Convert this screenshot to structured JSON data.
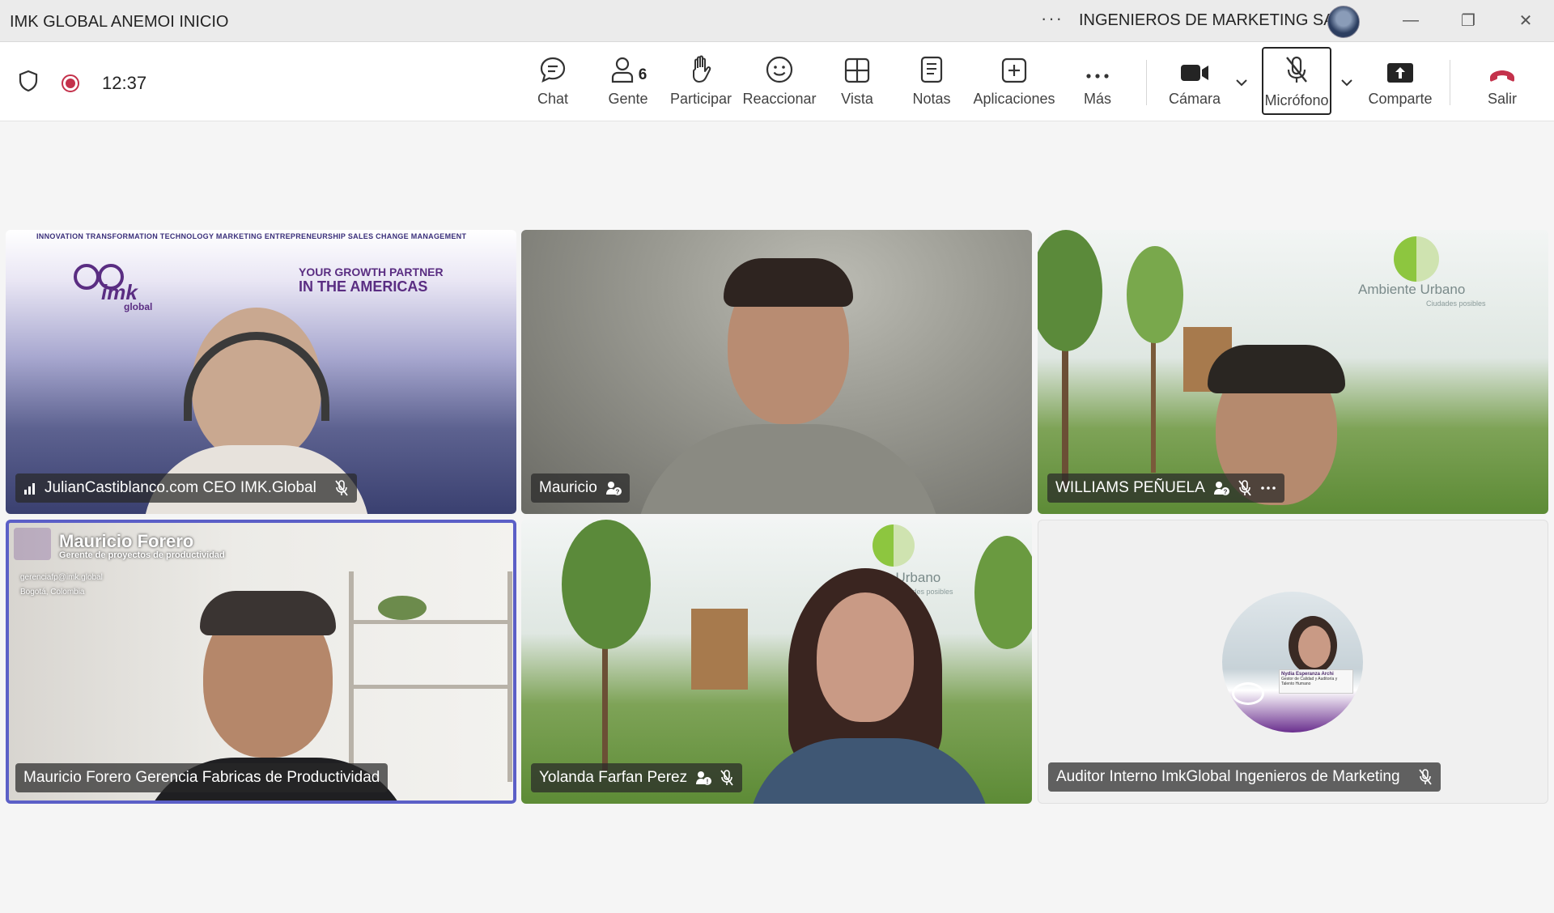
{
  "titlebar": {
    "title": "IMK GLOBAL ANEMOI INICIO",
    "more": "···",
    "organization": "INGENIEROS DE MARKETING SAS",
    "minimize": "—",
    "restore": "❐",
    "close": "✕"
  },
  "meeting": {
    "timer": "12:37"
  },
  "toolbar": {
    "chat": "Chat",
    "people": "Gente",
    "people_count": "6",
    "raise_hand": "Participar",
    "react": "Reaccionar",
    "view": "Vista",
    "notes": "Notas",
    "apps": "Aplicaciones",
    "more": "Más",
    "camera": "Cámara",
    "mic": "Micrófono",
    "share": "Comparte",
    "leave": "Salir"
  },
  "participants": [
    {
      "name": "JulianCastiblanco.com CEO IMK.Global",
      "background_tagline": "INNOVATION TRANSFORMATION TECHNOLOGY MARKETING ENTREPRENEURSHIP SALES CHANGE MANAGEMENT",
      "background_slogan_1": "YOUR GROWTH PARTNER",
      "background_slogan_2": "IN THE AMERICAS",
      "logo_text": "imk",
      "logo_sub": "global"
    },
    {
      "name": "Mauricio"
    },
    {
      "name": "WILLIAMS PEÑUELA",
      "background_brand": "Ambiente Urbano",
      "background_brand_sub": "Ciudades posibles"
    },
    {
      "name": "Mauricio Forero Gerencia Fabricas de Productividad",
      "overlay_name": "Mauricio Forero",
      "overlay_role": "Gerente de proyectos de productividad",
      "overlay_email": "gerenciafp@imk.global",
      "overlay_location": "Bogotá, Colombia"
    },
    {
      "name": "Yolanda Farfan Perez",
      "background_brand": "nbiente Urbano",
      "background_brand_sub": "Ciudades posibles"
    },
    {
      "name": "Auditor Interno ImkGlobal Ingenieros de Marketing",
      "avatar_name": "Nydia Esperanza Archi",
      "avatar_role": "Gestor de Calidad y Auditoría y Talento Humano"
    }
  ],
  "colors": {
    "record": "#c4314b",
    "leave": "#c4314b",
    "active_speaker": "#5b5fc7",
    "imk_purple": "#5a2d82"
  }
}
